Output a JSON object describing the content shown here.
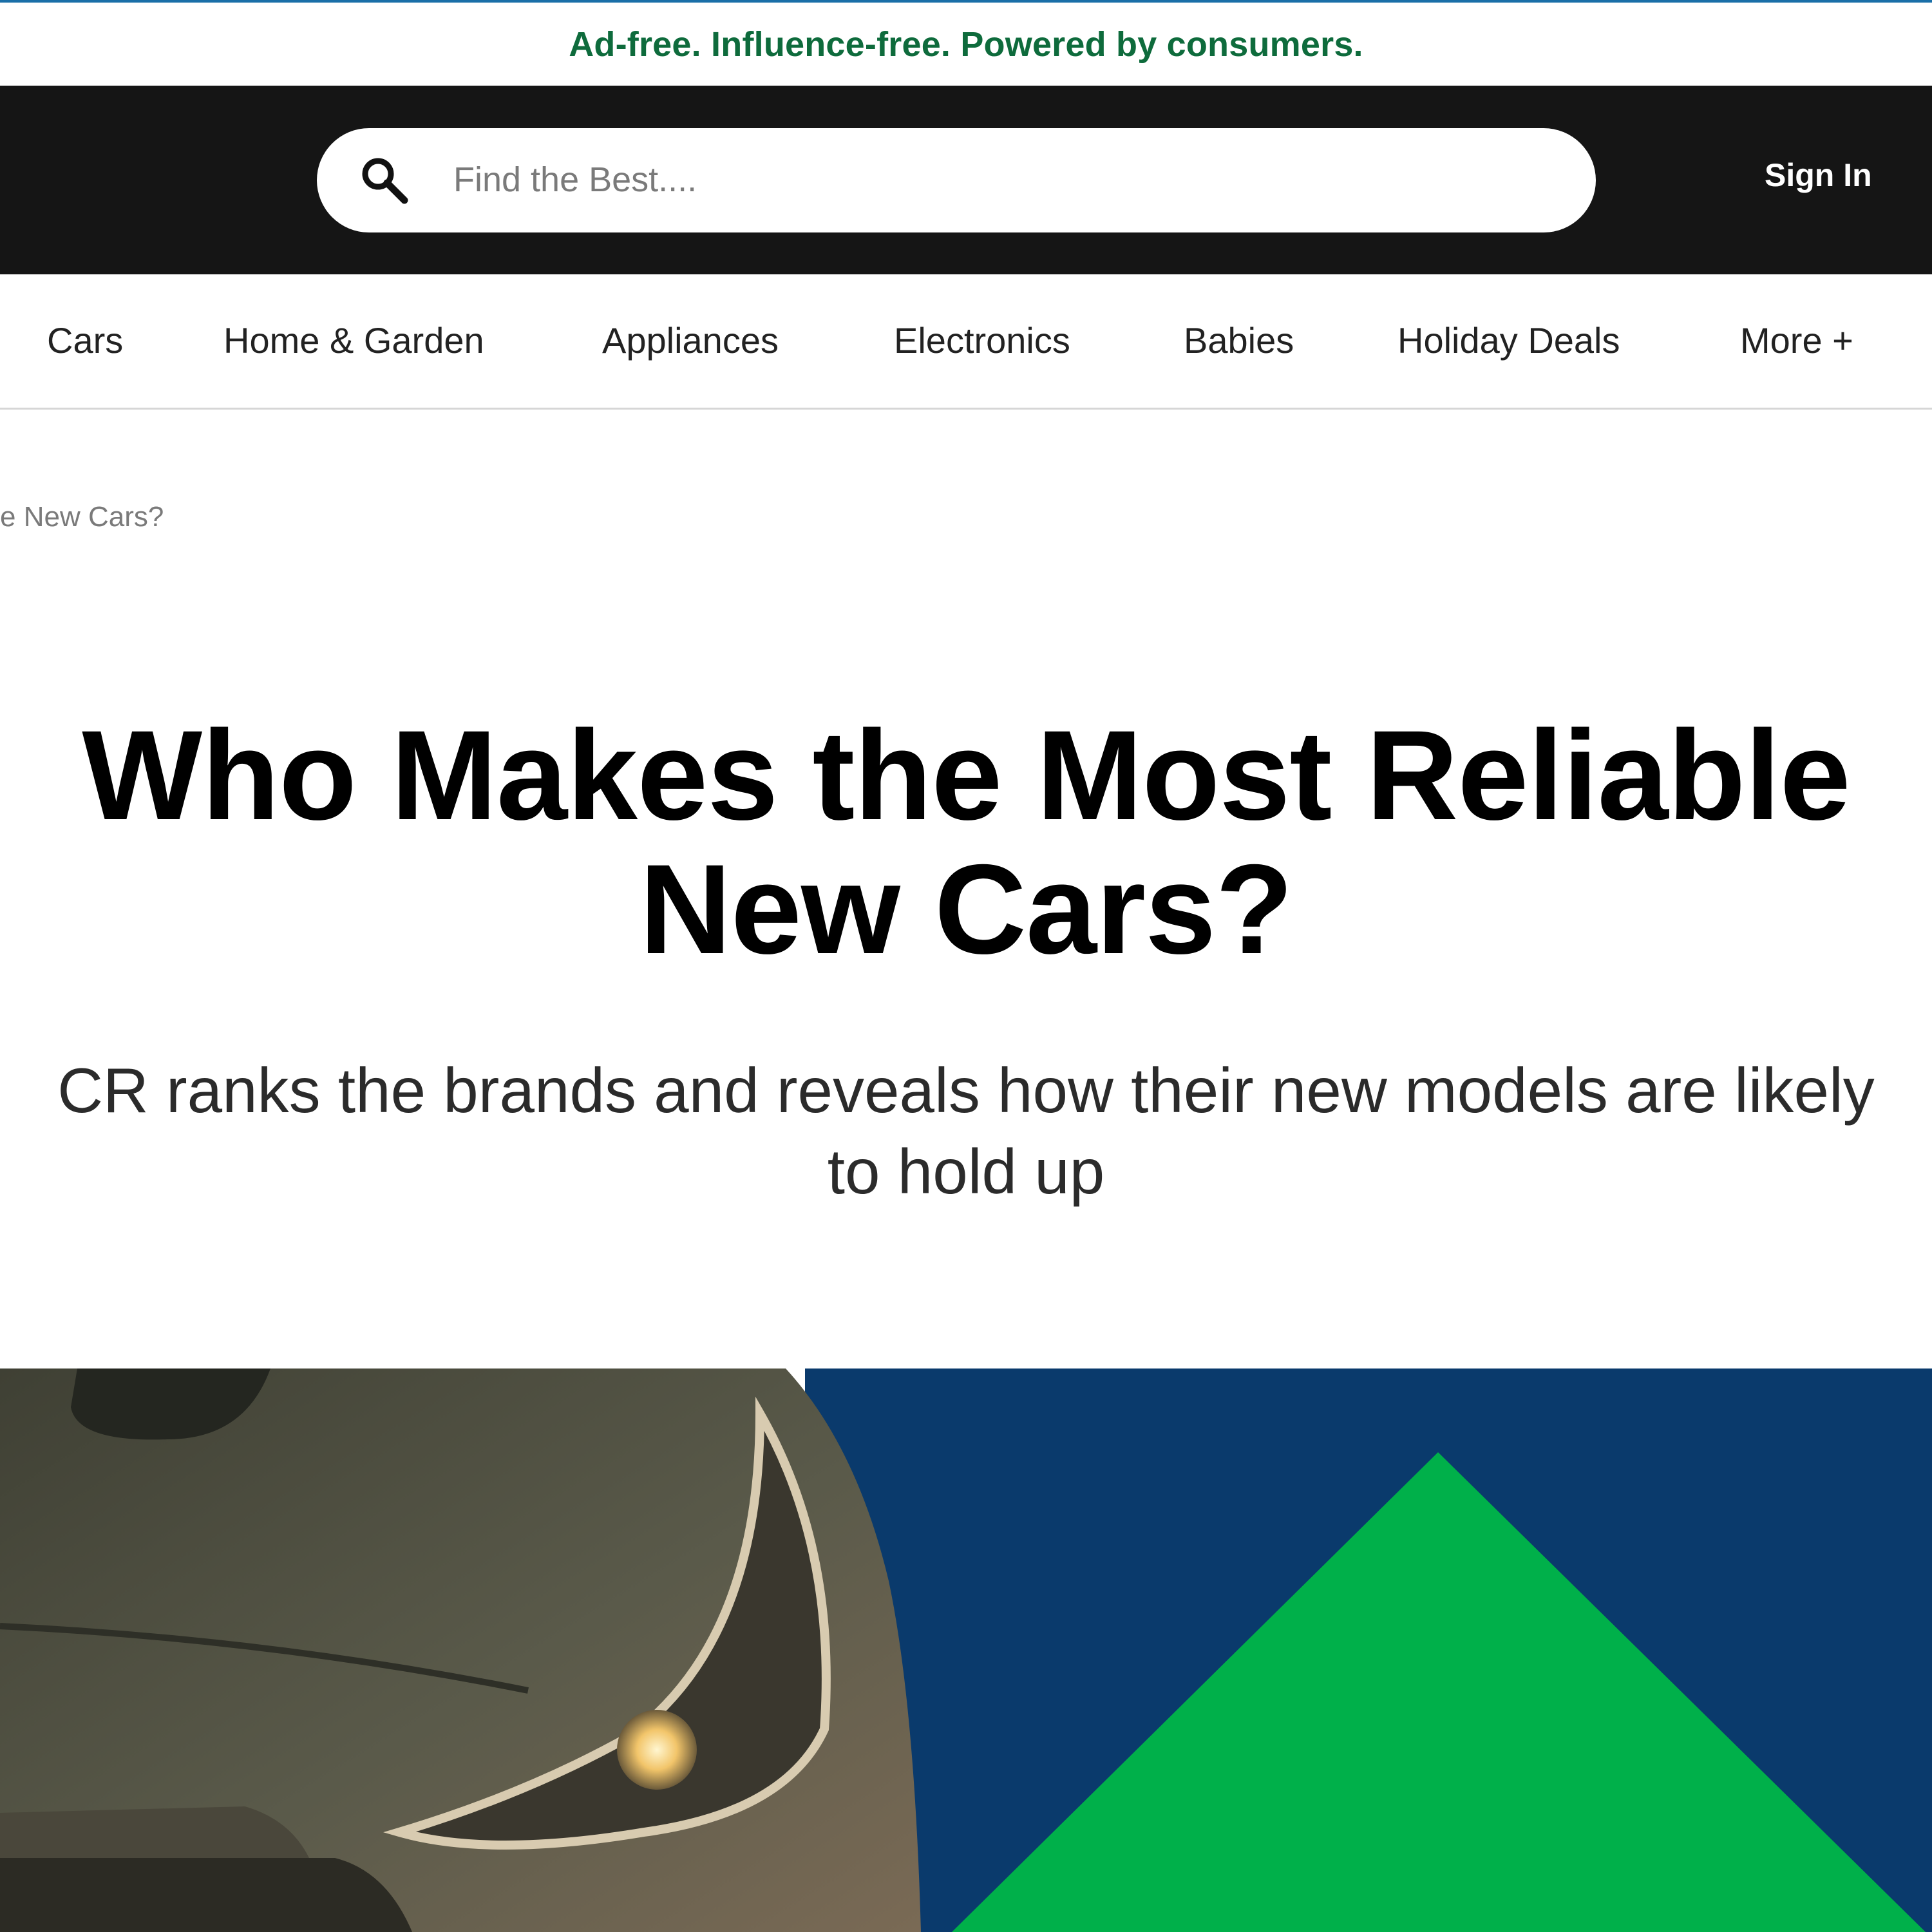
{
  "promo": {
    "text": "Ad-free. Influence-free. Powered by consumers."
  },
  "header": {
    "search": {
      "placeholder": "Find the Best...."
    },
    "sign_in_label": "Sign In"
  },
  "nav": {
    "items": [
      {
        "label": "Cars"
      },
      {
        "label": "Home & Garden"
      },
      {
        "label": "Appliances"
      },
      {
        "label": "Electronics"
      },
      {
        "label": "Babies"
      },
      {
        "label": "Holiday Deals"
      },
      {
        "label": "More +"
      }
    ]
  },
  "breadcrumb": {
    "text": "e New Cars?"
  },
  "article": {
    "headline": "Who Makes the Most Reliable New Cars?",
    "subheadline": "CR ranks the brands and reveals how their new models are likely to hold up"
  },
  "colors": {
    "header_bg": "#151515",
    "promo_text": "#0e6b3c",
    "hero_navy": "#0a3a6c",
    "hero_green": "#00b04a"
  }
}
